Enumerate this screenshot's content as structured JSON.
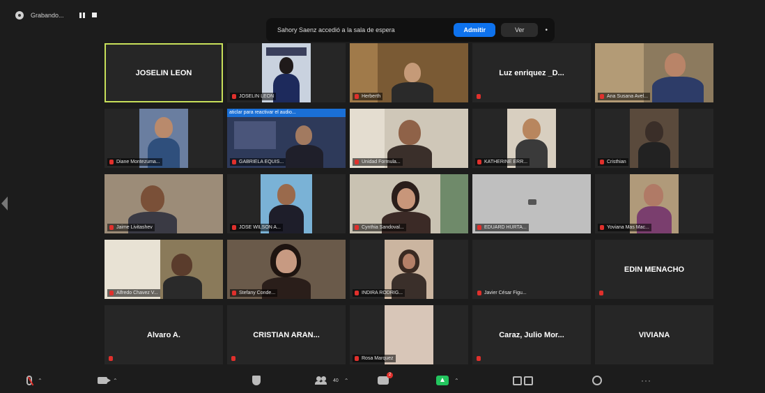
{
  "recording": {
    "label": "Grabando..."
  },
  "notification": {
    "message": "Sahory Saenz accedió a la sala de espera",
    "admit_label": "Admitir",
    "view_label": "Ver",
    "more_label": "•"
  },
  "participants": [
    {
      "name": "JOSELIN LEON",
      "display": "name",
      "active": true,
      "label": ""
    },
    {
      "label": "JOSELIN LEON",
      "display": "video"
    },
    {
      "label": "Herberth",
      "display": "video"
    },
    {
      "name": "Luz enriquez _D...",
      "display": "name",
      "label": ""
    },
    {
      "label": "Ana Susana Avel...",
      "display": "video"
    },
    {
      "label": "Diane Montezuma...",
      "display": "video"
    },
    {
      "label": "GABRIELA EQUIS...",
      "display": "video",
      "banner": "aticlar para reactivar el audio..."
    },
    {
      "label": "Unidad Formula...",
      "display": "video"
    },
    {
      "label": "KATHERINE ERR...",
      "display": "video"
    },
    {
      "label": "Cristhian",
      "display": "video"
    },
    {
      "label": "Jaime Livitashev",
      "display": "video"
    },
    {
      "label": "JOSE WILSON A...",
      "display": "video"
    },
    {
      "label": "Cynthia Sandoval...",
      "display": "video"
    },
    {
      "label": "EDUARD HURTA...",
      "display": "camoff"
    },
    {
      "label": "Yoviana Mas Mac...",
      "display": "video"
    },
    {
      "label": "Alfredo Chavez V...",
      "display": "video"
    },
    {
      "label": "Stefany Conde...",
      "display": "video"
    },
    {
      "label": "INDIRA RODRIG...",
      "display": "video"
    },
    {
      "label": "Javier César Figu...",
      "display": "blank"
    },
    {
      "name": "EDIN MENACHO",
      "display": "name",
      "label": ""
    },
    {
      "name": "Alvaro A.",
      "display": "name",
      "label": ""
    },
    {
      "name": "CRISTIAN ARAN...",
      "display": "name",
      "label": ""
    },
    {
      "label": "Rosa Marquez",
      "display": "video"
    },
    {
      "name": "Caraz, Julio Mor...",
      "display": "name",
      "label": ""
    },
    {
      "name": "VIVIANA",
      "display": "name",
      "label": ""
    }
  ],
  "toolbar": {
    "participants_count": "40",
    "chat_badge": "2",
    "more_label": "···"
  },
  "colors": {
    "admit": "#0e72ed",
    "active_border": "#c8e05a",
    "muted": "#e0302c",
    "share": "#23c55e"
  }
}
